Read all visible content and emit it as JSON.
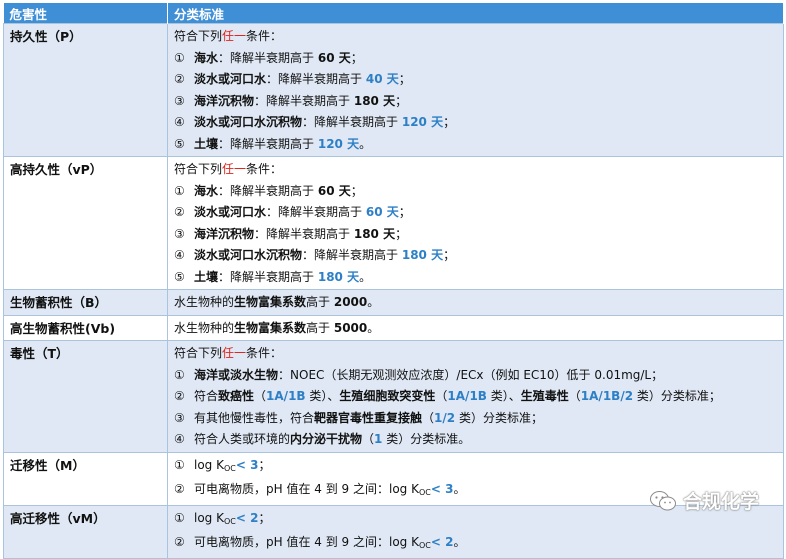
{
  "header": {
    "col1": "危害性",
    "col2": "分类标准"
  },
  "rows": {
    "p": {
      "name": "持久性（P）",
      "intro_a": "符合下列",
      "intro_red": "任一",
      "intro_b": "条件：",
      "items": [
        {
          "num": "①",
          "medium": "海水",
          "text": "：降解半衰期高于 ",
          "value": "60 天",
          "tail": "；"
        },
        {
          "num": "②",
          "medium": "淡水或河口水",
          "text": "：降解半衰期高于 ",
          "value": "40 天",
          "tail": "；"
        },
        {
          "num": "③",
          "medium": "海洋沉积物",
          "text": "：降解半衰期高于 ",
          "value": "180 天",
          "tail": "；"
        },
        {
          "num": "④",
          "medium": "淡水或河口水沉积物",
          "text": "：降解半衰期高于 ",
          "value": "120 天",
          "tail": "；"
        },
        {
          "num": "⑤",
          "medium": "土壤",
          "text": "：降解半衰期高于 ",
          "value": "120 天",
          "tail": "。"
        }
      ]
    },
    "vp": {
      "name": "高持久性（vP）",
      "intro_a": "符合下列",
      "intro_red": "任一",
      "intro_b": "条件：",
      "items": [
        {
          "num": "①",
          "medium": "海水",
          "text": "：降解半衰期高于 ",
          "value": "60 天",
          "tail": "；"
        },
        {
          "num": "②",
          "medium": "淡水或河口水",
          "text": "：降解半衰期高于 ",
          "value": "60 天",
          "tail": "；"
        },
        {
          "num": "③",
          "medium": "海洋沉积物",
          "text": "：降解半衰期高于 ",
          "value": "180 天",
          "tail": "；"
        },
        {
          "num": "④",
          "medium": "淡水或河口水沉积物",
          "text": "：降解半衰期高于 ",
          "value": "180 天",
          "tail": "；"
        },
        {
          "num": "⑤",
          "medium": "土壤",
          "text": "：降解半衰期高于 ",
          "value": "180 天",
          "tail": "。"
        }
      ]
    },
    "b": {
      "name": "生物蓄积性（B）",
      "a": "水生物种的",
      "bold": "生物富集系数",
      "b": "高于 ",
      "value": "2000",
      "tail": "。"
    },
    "vb": {
      "name": "高生物蓄积性(Vb)",
      "a": "水生物种的",
      "bold": "生物富集系数",
      "b": "高于 ",
      "value": "5000",
      "tail": "。"
    },
    "t": {
      "name": "毒性（T）",
      "intro_a": "符合下列",
      "intro_red": "任一",
      "intro_b": "条件：",
      "l1": {
        "num": "①",
        "bold": "海洋或淡水生物",
        "text": "：NOEC（长期无观测效应浓度）/ECx（例如 EC10）低于 0.01mg/L；"
      },
      "l2": {
        "num": "②",
        "a": "符合",
        "b1": "致癌性",
        "p1a": "（",
        "v1": "1A/1B",
        "p1b": " 类）、",
        "b2": "生殖细胞致突变性",
        "p2a": "（",
        "v2": "1A/1B",
        "p2b": " 类）、",
        "b3": "生殖毒性",
        "p3a": "（",
        "v3": "1A/1B/2",
        "p3b": " 类）分类标准；"
      },
      "l3": {
        "num": "③",
        "a": "有其他慢性毒性，符合",
        "b1": "靶器官毒性重复接触",
        "p1": "（",
        "v1": "1/2",
        "p2": " 类）分类标准；"
      },
      "l4": {
        "num": "④",
        "a": "符合人类或环境的",
        "b1": "内分泌干扰物",
        "p1": "（",
        "v1": "1",
        "p2": " 类）分类标准。"
      }
    },
    "m": {
      "name": "迁移性（M）",
      "l1": {
        "num": "①",
        "a": "log K",
        "sub": "OC",
        "op": "< 3",
        "tail": "；"
      },
      "l2": {
        "num": "②",
        "a": "可电离物质，pH 值在 4 到 9 之间：log K",
        "sub": "OC",
        "op": "< 3",
        "tail": "。"
      }
    },
    "vm": {
      "name": "高迁移性（vM）",
      "l1": {
        "num": "①",
        "a": "log K",
        "sub": "OC",
        "op": "< 2",
        "tail": "；"
      },
      "l2": {
        "num": "②",
        "a": "可电离物质，pH 值在 4 到 9 之间：log K",
        "sub": "OC",
        "op": "< 2",
        "tail": "。"
      }
    }
  },
  "watermark": {
    "text": "合规化学",
    "icon": "wechat-icon"
  },
  "colors": {
    "header_bg": "#3f8fd6",
    "band_bg": "#dfe8f4",
    "accent_blue": "#2d7fc6",
    "accent_red": "#e0241b"
  }
}
